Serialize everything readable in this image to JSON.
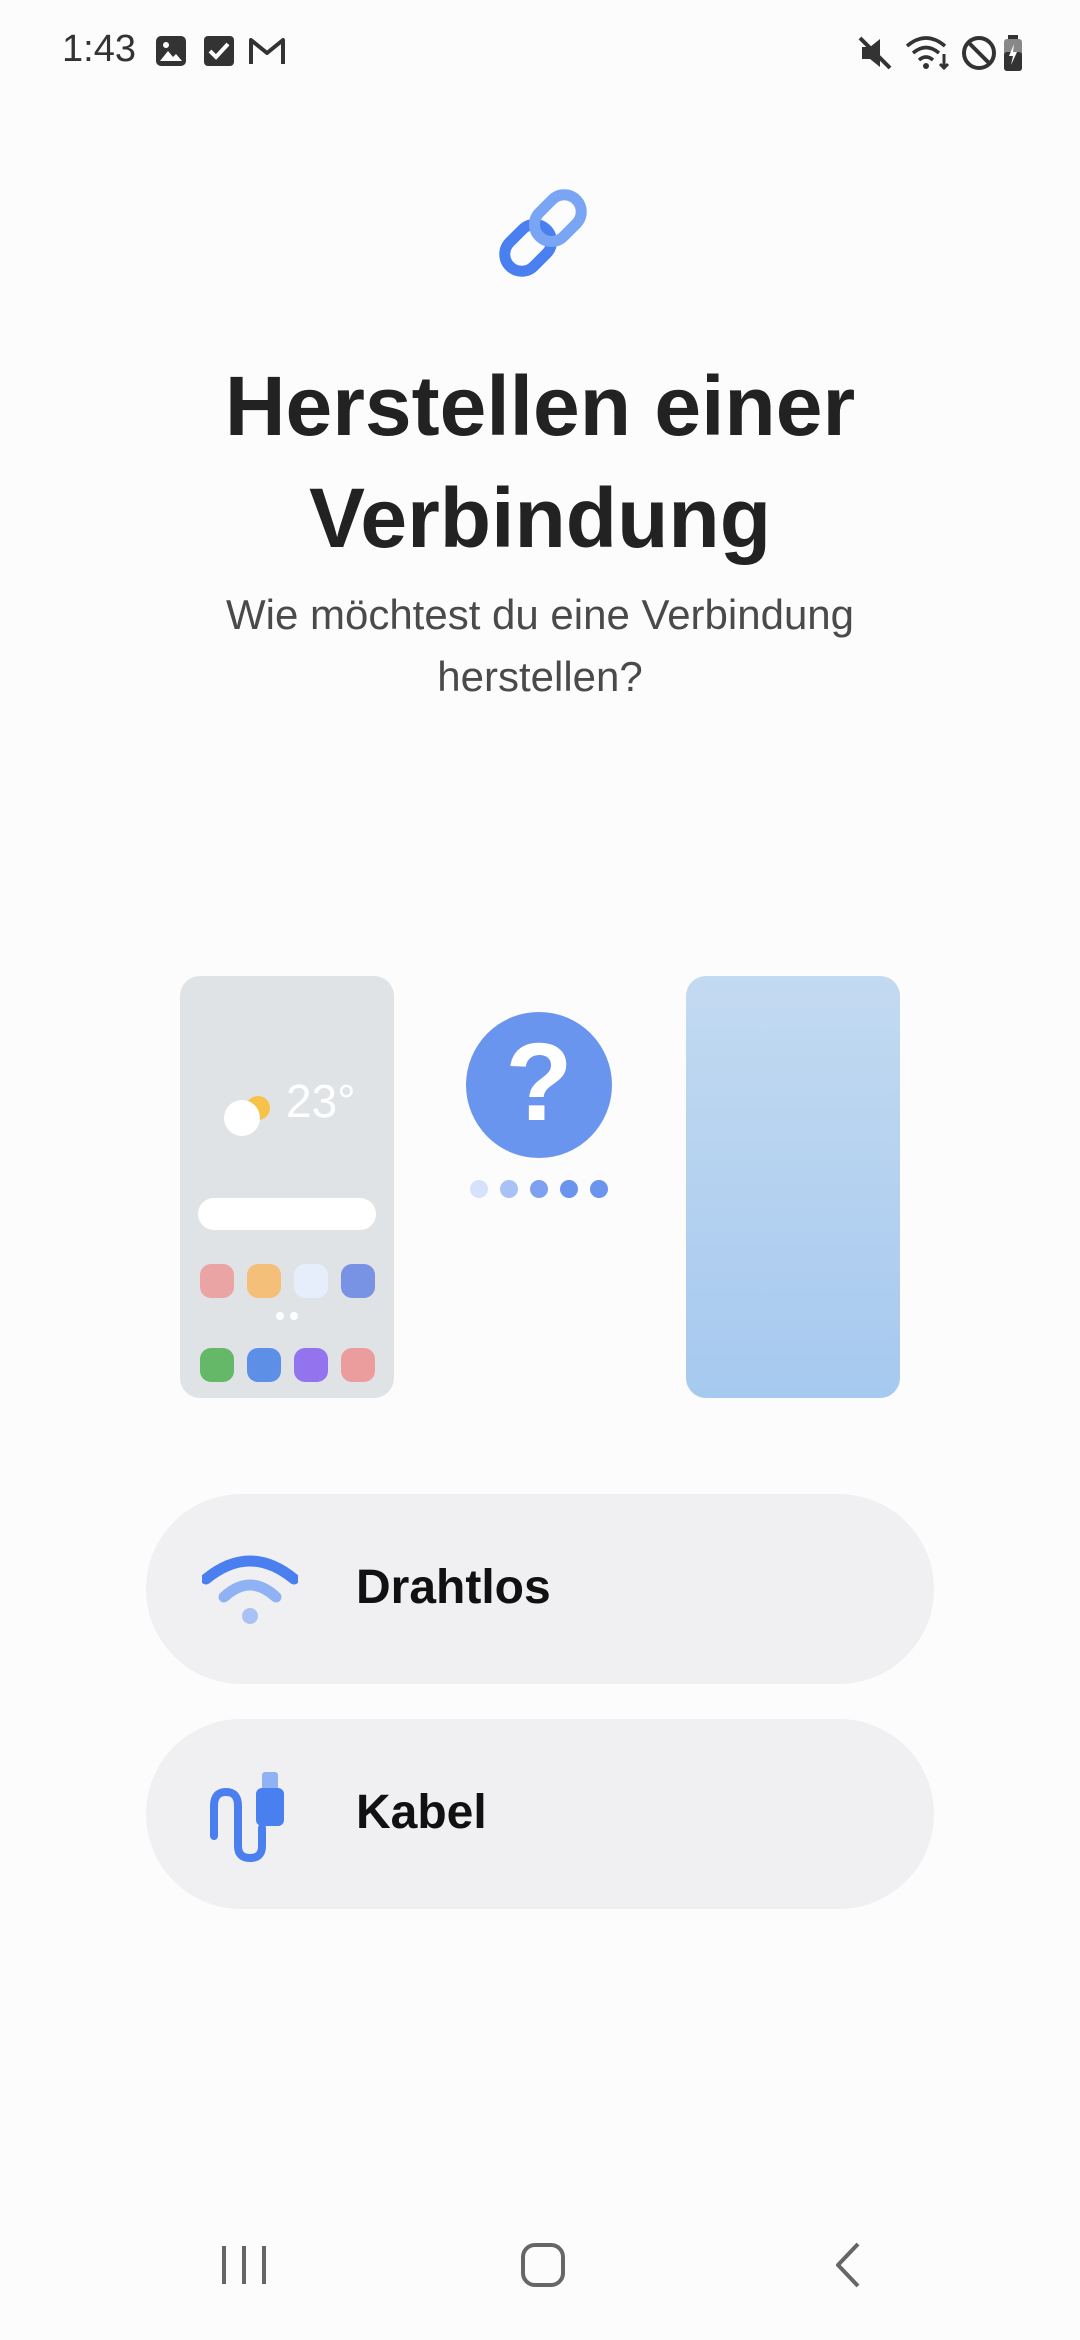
{
  "status_bar": {
    "time": "1:43",
    "left_icons": [
      "gallery-icon",
      "checkbox-icon",
      "gmail-icon"
    ],
    "right_icons": [
      "mute-icon",
      "wifi-icon",
      "do-not-disturb-icon",
      "battery-icon"
    ]
  },
  "header": {
    "icon": "link-icon",
    "title_line1": "Herstellen einer",
    "title_line2": "Verbindung",
    "subtitle_line1": "Wie möchtest du eine Verbindung",
    "subtitle_line2": "herstellen?"
  },
  "illustration": {
    "weather_temp": "23°",
    "question": "?",
    "colors": {
      "accent": "#6a95ee",
      "phone_left": "#e0e3e6",
      "phone_right_top": "#c3daf1",
      "phone_right_bottom": "#a6c9ef"
    }
  },
  "options": [
    {
      "label": "Drahtlos",
      "icon": "wifi-icon"
    },
    {
      "label": "Kabel",
      "icon": "cable-icon"
    }
  ],
  "nav_bar": {
    "icons": [
      "recent-apps-icon",
      "home-icon",
      "back-icon"
    ]
  }
}
